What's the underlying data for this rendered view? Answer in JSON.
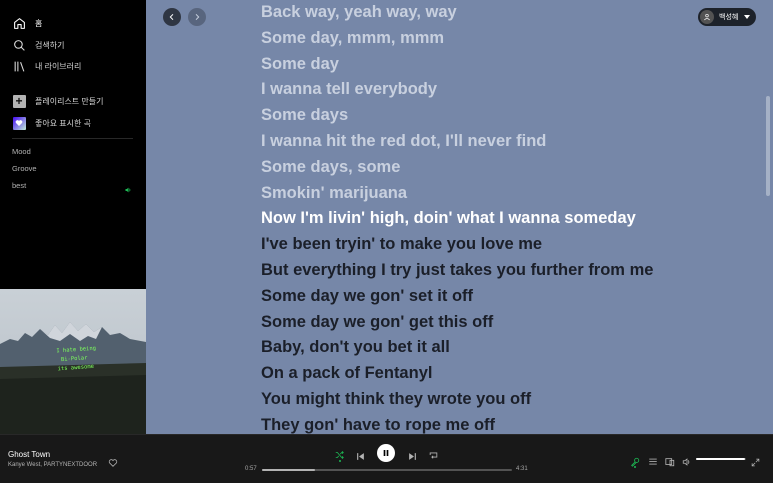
{
  "sidebar": {
    "nav": [
      {
        "label": "홈",
        "icon": "home-icon"
      },
      {
        "label": "검색하기",
        "icon": "search-icon"
      },
      {
        "label": "내 라이브러리",
        "icon": "library-icon"
      }
    ],
    "actions": [
      {
        "label": "플레이리스트 만들기",
        "icon": "plus-icon"
      },
      {
        "label": "좋아요 표시한 곡",
        "icon": "heart-icon"
      }
    ],
    "playlists": [
      "Mood",
      "Groove",
      "best"
    ]
  },
  "header": {
    "user_name": "백성혜"
  },
  "lyrics": {
    "lines": [
      "Back way, yeah way, way",
      "Some day, mmm, mmm",
      "Some day",
      "I wanna tell everybody",
      "Some days",
      "I wanna hit the red dot, I'll never find",
      "Some days, some",
      "Smokin' marijuana",
      "Now I'm livin' high, doin' what I wanna someday",
      "I've been tryin' to make you love me",
      "But everything I try just takes you further from me",
      "Some day we gon' set it off",
      "Some day we gon' get this off",
      "Baby, don't you bet it all",
      "On a pack of Fentanyl",
      "You might think they wrote you off",
      "They gon' have to rope me off"
    ],
    "current_index": 8
  },
  "cover": {
    "handwriting": [
      "I hate being",
      "Bi-Polar",
      "its awesome"
    ]
  },
  "player": {
    "title": "Ghost Town",
    "artist": "Kanye West, PARTYNEXTDOOR",
    "elapsed": "0:57",
    "duration": "4:31",
    "progress_fraction": 0.21,
    "volume_fraction": 0.98,
    "shuffle_active": true,
    "lyrics_active": true
  },
  "colors": {
    "lyrics_background": "#7687a8",
    "accent_green": "#1db954"
  }
}
